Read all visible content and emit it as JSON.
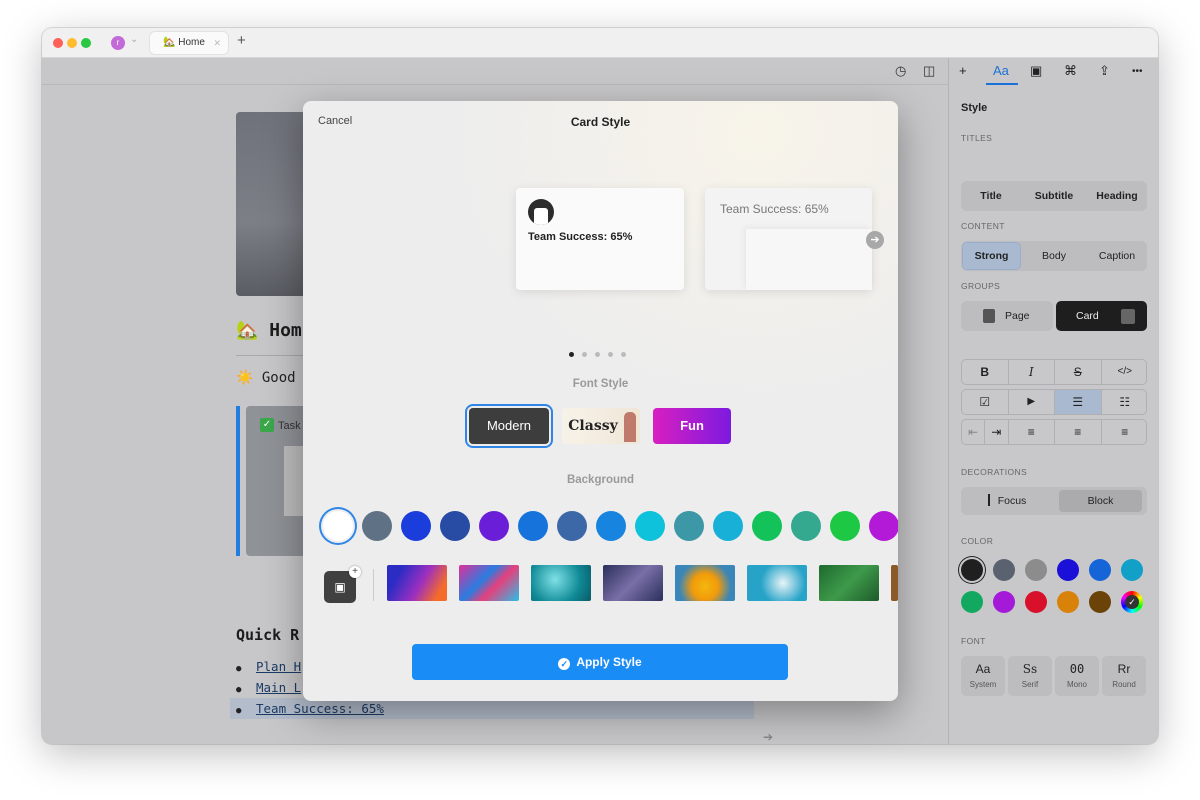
{
  "window": {
    "tab_title": "Home",
    "tab_emoji": "🏡",
    "avatar_letter": "r",
    "new_tab_glyph": "+"
  },
  "document": {
    "title": "🏡 Hom",
    "greeting": "☀️ Good",
    "task_label": "Task",
    "quick_heading": "Quick R",
    "quick_links": [
      "Plan H",
      "Main L",
      "Team Success: 65%"
    ]
  },
  "sidebar": {
    "tabs": [
      {
        "icon": "plus-icon",
        "glyph": "+"
      },
      {
        "icon": "text-style-icon",
        "glyph": "Aa",
        "active": true
      },
      {
        "icon": "device-icon",
        "glyph": "▣"
      },
      {
        "icon": "command-icon",
        "glyph": "⌘"
      },
      {
        "icon": "share-icon",
        "glyph": "⇪"
      },
      {
        "icon": "more-icon",
        "glyph": "•••"
      }
    ],
    "panel_title": "Style",
    "titles_label": "TITLES",
    "titles": [
      "Title",
      "Subtitle",
      "Heading"
    ],
    "content_label": "CONTENT",
    "content": [
      "Strong",
      "Body",
      "Caption"
    ],
    "groups_label": "GROUPS",
    "groups": [
      "Page",
      "Card"
    ],
    "decorations_label": "DECORATIONS",
    "decorations": [
      "Focus",
      "Block"
    ],
    "color_label": "COLOR",
    "colors": [
      "#1f1f1f",
      "#5a6270",
      "#8c8c8c",
      "#1a10d8",
      "#1565d8",
      "#12a0c8",
      "#12a860",
      "#a51ad9",
      "#d8102a",
      "#d8820a",
      "#6b4208",
      "#dcdcdc"
    ],
    "font_label": "FONT",
    "fonts": [
      {
        "glyph": "Aa",
        "name": "System"
      },
      {
        "glyph": "Ss",
        "name": "Serif"
      },
      {
        "glyph": "00",
        "name": "Mono"
      },
      {
        "glyph": "Rr",
        "name": "Round"
      }
    ]
  },
  "modal": {
    "cancel_label": "Cancel",
    "title": "Card Style",
    "preview_text": "Team Success: 65%",
    "preview_text_2": "Team Success: 65%",
    "page_count": 5,
    "current_page": 1,
    "font_style_label": "Font Style",
    "font_styles": [
      "Modern",
      "Classy",
      "Fun"
    ],
    "background_label": "Background",
    "background_colors": [
      "#ffffff",
      "#5f7185",
      "#1b3ddb",
      "#284ba4",
      "#6a1ed8",
      "#1673db",
      "#3c68a8",
      "#1784e0",
      "#0fc2dc",
      "#3c97a6",
      "#18b0d6",
      "#14c25a",
      "#35a890",
      "#1dc845",
      "#b21ad8"
    ],
    "apply_label": "Apply Style"
  }
}
